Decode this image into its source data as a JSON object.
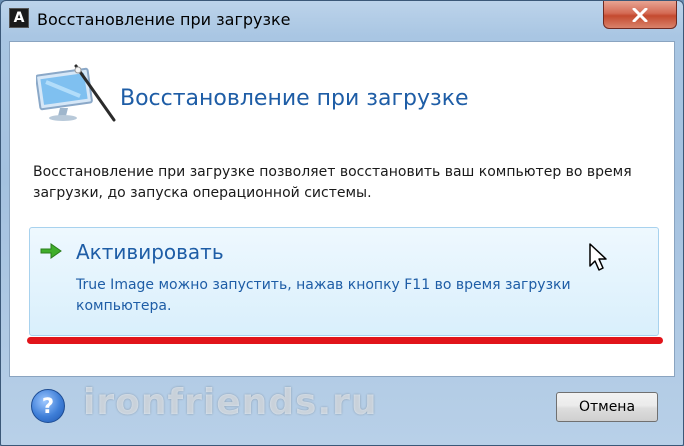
{
  "window": {
    "title": "Восстановление при загрузке",
    "app_icon_letter": "A"
  },
  "header": {
    "title": "Восстановление при загрузке",
    "icon": "computer-wand-icon"
  },
  "description": "Восстановление при загрузке позволяет восстановить ваш компьютер во время загрузки, до запуска операционной системы.",
  "activate": {
    "title": "Активировать",
    "description": "True Image можно запустить, нажав кнопку F11 во время загрузки компьютера.",
    "icon": "green-arrow-icon"
  },
  "footer": {
    "help_symbol": "?",
    "watermark": "ironfriends.ru",
    "cancel_label": "Отмена"
  },
  "colors": {
    "accent_blue": "#1e5da6",
    "highlight_red": "#e1141a",
    "panel_bg": "#d9effc"
  }
}
